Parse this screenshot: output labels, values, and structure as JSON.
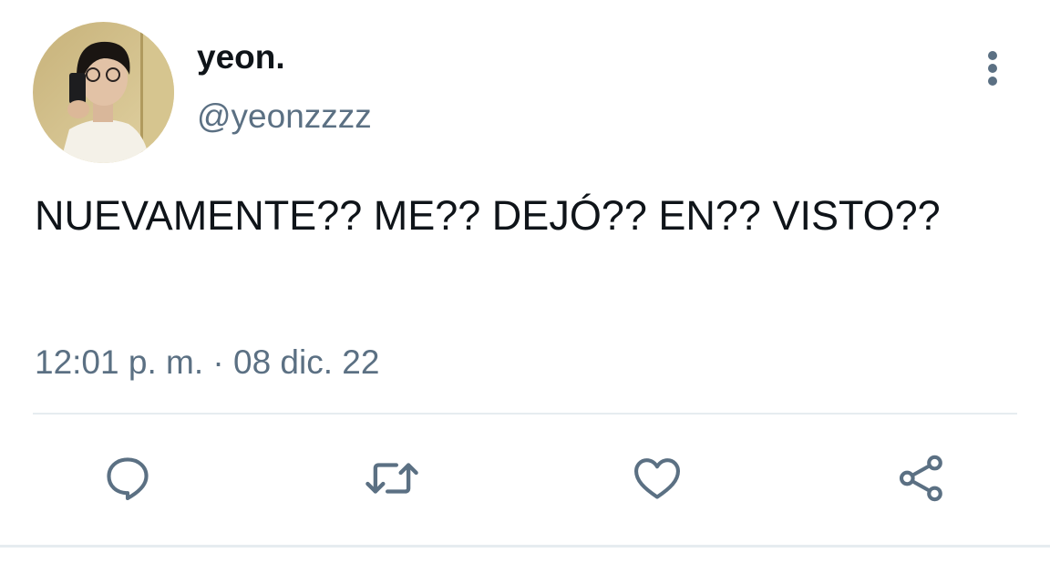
{
  "tweet": {
    "author": {
      "display_name": "yeon.",
      "handle": "@yeonzzzz"
    },
    "text": "NUEVAMENTE?? ME?? DEJÓ?? EN?? VISTO??",
    "timestamp": "12:01 p. m. · 08 dic. 22"
  },
  "actions": [
    {
      "icon": "reply-icon"
    },
    {
      "icon": "retweet-icon"
    },
    {
      "icon": "like-icon"
    },
    {
      "icon": "share-icon"
    }
  ],
  "colors": {
    "text_primary": "#0f1419",
    "text_secondary": "#5b7083",
    "icon": "#5b7083",
    "divider": "#e6ecf0"
  }
}
